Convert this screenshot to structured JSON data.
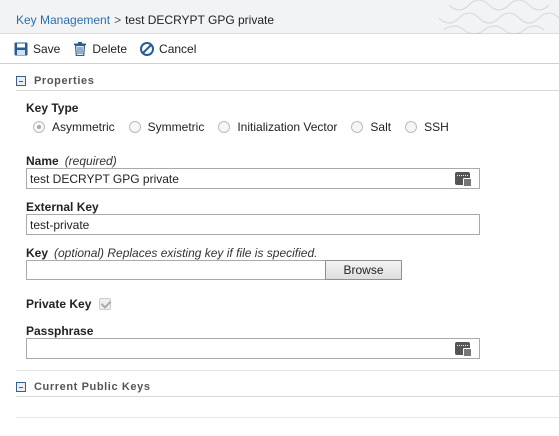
{
  "breadcrumb": {
    "parent": "Key Management",
    "separator": ">",
    "current": "test DECRYPT GPG private"
  },
  "toolbar": {
    "save_label": "Save",
    "delete_label": "Delete",
    "cancel_label": "Cancel"
  },
  "sections": {
    "properties": "Properties",
    "current_public_keys": "Current Public Keys"
  },
  "form": {
    "key_type_label": "Key Type",
    "key_types": [
      "Asymmetric",
      "Symmetric",
      "Initialization Vector",
      "Salt",
      "SSH"
    ],
    "selected_key_type": "Asymmetric",
    "name_label": "Name",
    "name_note": "(required)",
    "name_value": "test DECRYPT GPG private",
    "external_key_label": "External Key",
    "external_key_value": "test-private",
    "key_label": "Key",
    "key_note": "(optional) Replaces existing key if file is specified.",
    "key_value": "",
    "browse_label": "Browse",
    "private_key_label": "Private Key",
    "private_key_checked": true,
    "passphrase_label": "Passphrase",
    "passphrase_value": ""
  },
  "colors": {
    "link": "#2a6fb0",
    "header_bg": "#f1f3f4",
    "toolbar_icon": "#2a5c8f"
  }
}
